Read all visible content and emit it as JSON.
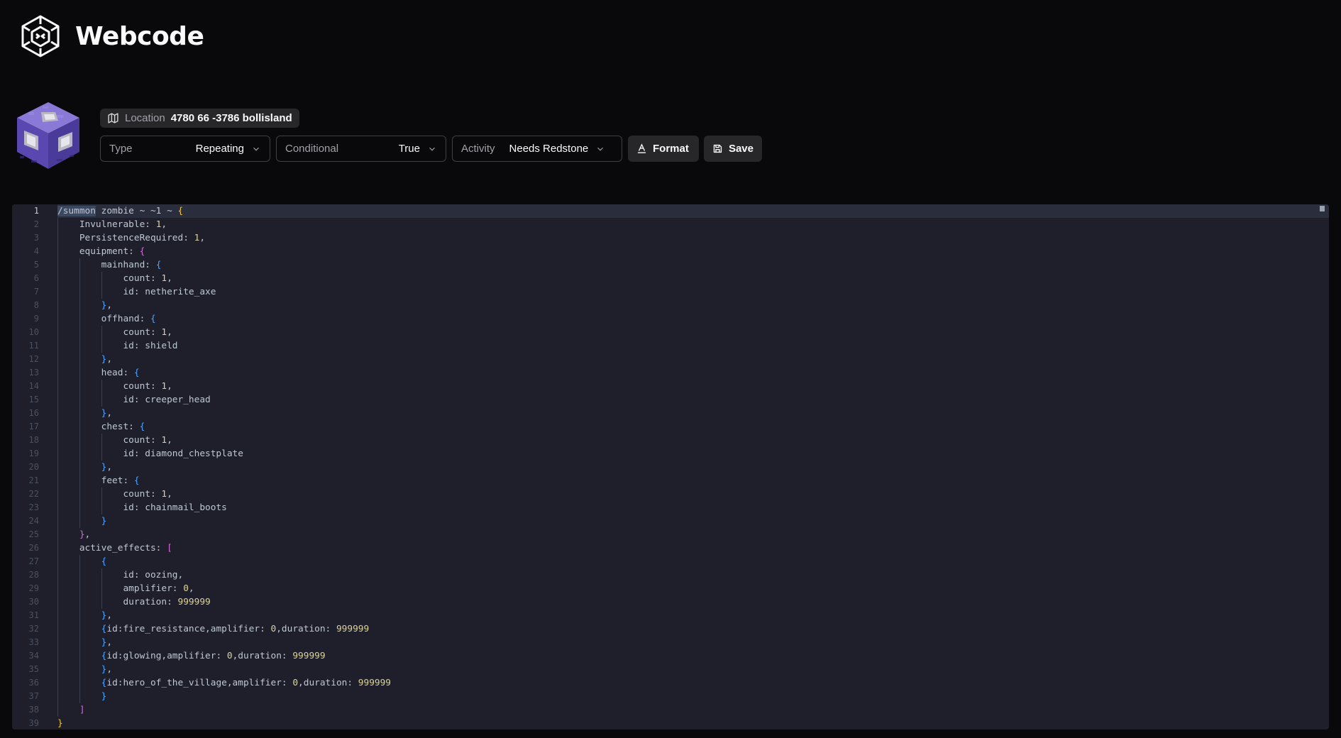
{
  "app": {
    "name": "Webcode"
  },
  "location": {
    "label": "Location",
    "value": "4780 66 -3786 bollisland"
  },
  "controls": {
    "type": {
      "label": "Type",
      "value": "Repeating"
    },
    "conditional": {
      "label": "Conditional",
      "value": "True"
    },
    "activity": {
      "label": "Activity",
      "value": "Needs Redstone"
    },
    "format_label": "Format",
    "save_label": "Save"
  },
  "editor": {
    "active_line": 1,
    "lines": [
      "/summon zombie ~ ~1 ~ {",
      "    Invulnerable: 1,",
      "    PersistenceRequired: 1,",
      "    equipment: {",
      "        mainhand: {",
      "            count: 1,",
      "            id: netherite_axe",
      "        },",
      "        offhand: {",
      "            count: 1,",
      "            id: shield",
      "        },",
      "        head: {",
      "            count: 1,",
      "            id: creeper_head",
      "        },",
      "        chest: {",
      "            count: 1,",
      "            id: diamond_chestplate",
      "        },",
      "        feet: {",
      "            count: 1,",
      "            id: chainmail_boots",
      "        }",
      "    },",
      "    active_effects: [",
      "        {",
      "            id: oozing,",
      "            amplifier: 0,",
      "            duration: 999999",
      "        },",
      "        {id:fire_resistance,amplifier: 0,duration: 999999",
      "        },",
      "        {id:glowing,amplifier: 0,duration: 999999",
      "        },",
      "        {id:hero_of_the_village,amplifier: 0,duration: 999999",
      "        }",
      "    ]",
      "}"
    ]
  }
}
